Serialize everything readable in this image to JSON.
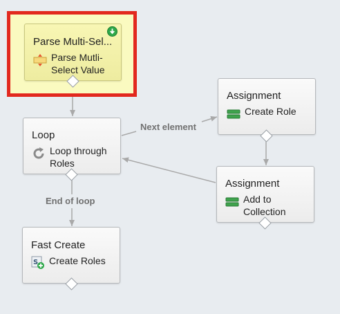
{
  "edge_labels": {
    "next_element": "Next element",
    "end_of_loop": "End of loop"
  },
  "nodes": {
    "parse": {
      "type": "Parse Multi-Sel...",
      "label_line1": "Parse Mutli-",
      "label_line2": "Select Value",
      "icon": "decision-icon"
    },
    "loop": {
      "type": "Loop",
      "label_line1": "Loop through",
      "label_line2": "Roles",
      "icon": "loop-icon"
    },
    "fast_create": {
      "type": "Fast Create",
      "label_line1": "Create Roles",
      "icon": "fast-create-icon"
    },
    "assign_role": {
      "type": "Assignment",
      "label_line1": "Create Role",
      "icon": "assignment-icon"
    },
    "assign_collection": {
      "type": "Assignment",
      "label_line1": "Add to",
      "label_line2": "Collection",
      "icon": "assignment-icon"
    }
  },
  "colors": {
    "highlight_border": "#e2281e",
    "start_node_fill": "#f4f2ac",
    "start_badge": "#2ea84a",
    "connector": "#a9a9a9"
  }
}
